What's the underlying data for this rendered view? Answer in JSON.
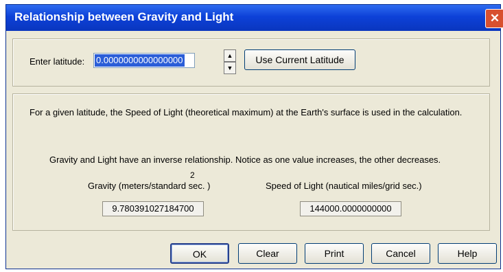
{
  "window": {
    "title": "Relationship between Gravity and Light",
    "close_symbol": "✕"
  },
  "latitude": {
    "label": "Enter latitude:",
    "value": "0.0000000000000000",
    "spin_up_symbol": "▲",
    "spin_down_symbol": "▼",
    "use_current_label": "Use Current Latitude"
  },
  "info": {
    "description": "For a given latitude, the Speed of Light (theoretical maximum) at the Earth's surface is used in the calculation.",
    "relationship": "Gravity and Light have an inverse relationship.  Notice as one value increases, the other decreases.",
    "gravity_label": "Gravity (meters/standard sec.  )",
    "gravity_exponent": "2",
    "gravity_value": "9.780391027184700",
    "light_label": "Speed of Light (nautical miles/grid sec.)",
    "light_value": "144000.0000000000"
  },
  "buttons": {
    "ok": "OK",
    "clear": "Clear",
    "print": "Print",
    "cancel": "Cancel",
    "help": "Help"
  },
  "colors": {
    "title_bar": "#0d41d8",
    "dialog_bg": "#ece9d8",
    "selection": "#2b5ed8",
    "close_button": "#d8502f"
  },
  "icons": {
    "close": "close-icon",
    "spin_up": "arrow-up-icon",
    "spin_down": "arrow-down-icon"
  }
}
